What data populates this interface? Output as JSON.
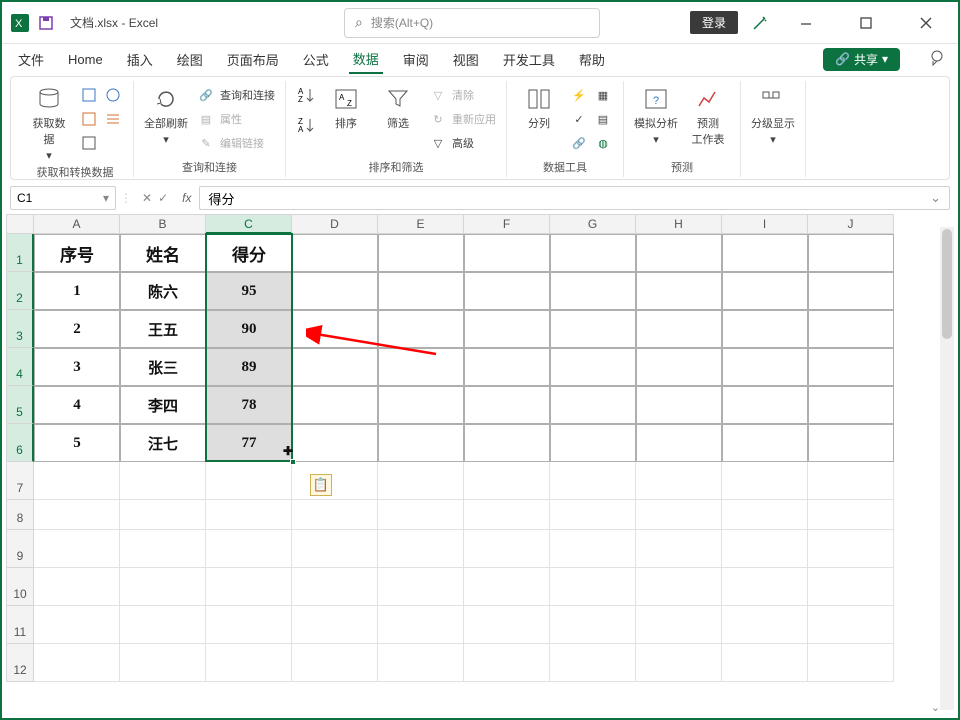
{
  "titlebar": {
    "filename": "文档.xlsx",
    "app": "Excel",
    "title_sep": " - ",
    "search_placeholder": "搜索(Alt+Q)",
    "login": "登录"
  },
  "menu": {
    "items": [
      "文件",
      "Home",
      "插入",
      "绘图",
      "页面布局",
      "公式",
      "数据",
      "审阅",
      "视图",
      "开发工具",
      "帮助"
    ],
    "active_index": 6,
    "share": "共享"
  },
  "ribbon": {
    "groups": {
      "g1": {
        "label": "获取和转换数据",
        "btn1": "获取数\n据"
      },
      "g2": {
        "label": "查询和连接",
        "bigbtn": "全部刷新",
        "item1": "查询和连接",
        "item2": "属性",
        "item3": "编辑链接"
      },
      "g3": {
        "label": "排序和筛选",
        "sort": "排序",
        "filter": "筛选",
        "clear": "清除",
        "reapply": "重新应用",
        "advanced": "高级"
      },
      "g4": {
        "label": "数据工具",
        "split": "分列"
      },
      "g5": {
        "label": "预测",
        "whatif": "模拟分析",
        "forecast": "预测\n工作表"
      },
      "g6": {
        "label": "",
        "outline": "分级显示"
      }
    }
  },
  "namebox": {
    "ref": "C1"
  },
  "formula": {
    "value": "得分"
  },
  "col_headers": [
    "A",
    "B",
    "C",
    "D",
    "E",
    "F",
    "G",
    "H",
    "I",
    "J"
  ],
  "row_headers": [
    "1",
    "2",
    "3",
    "4",
    "5",
    "6",
    "7",
    "8",
    "9",
    "10",
    "11",
    "12"
  ],
  "table": {
    "headers": [
      "序号",
      "姓名",
      "得分"
    ],
    "rows": [
      {
        "no": "1",
        "name": "陈六",
        "score": "95"
      },
      {
        "no": "2",
        "name": "王五",
        "score": "90"
      },
      {
        "no": "3",
        "name": "张三",
        "score": "89"
      },
      {
        "no": "4",
        "name": "李四",
        "score": "78"
      },
      {
        "no": "5",
        "name": "汪七",
        "score": "77"
      }
    ]
  },
  "chart_data": {
    "type": "table",
    "columns": [
      "序号",
      "姓名",
      "得分"
    ],
    "rows": [
      [
        1,
        "陈六",
        95
      ],
      [
        2,
        "王五",
        90
      ],
      [
        3,
        "张三",
        89
      ],
      [
        4,
        "李四",
        78
      ],
      [
        5,
        "汪七",
        77
      ]
    ]
  }
}
